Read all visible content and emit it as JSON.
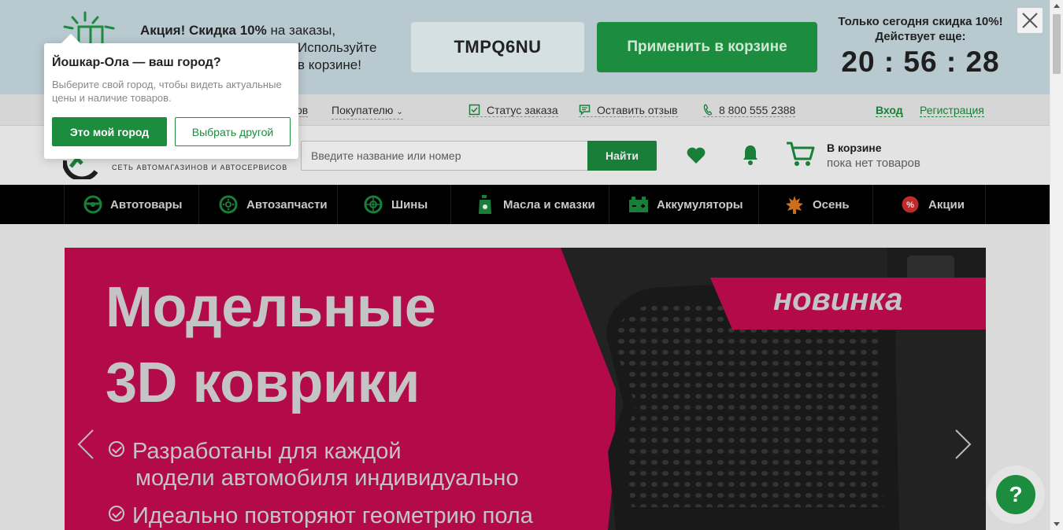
{
  "promo": {
    "bold": "Акция! Скидка 10%",
    "text": " на заказы,",
    "text2": "Используйте",
    "text3": "в корзине!",
    "code": "TMPQ6NU",
    "apply_label": "Применить в корзине",
    "timer_title_1": "Только сегодня скидка 10%!",
    "timer_title_2": "Действует еще:",
    "timer": "20 : 56 : 28"
  },
  "subnav": {
    "partial_item": "ов",
    "buyer": "Покупателю",
    "order_status": "Статус заказа",
    "leave_review": "Оставить отзыв",
    "phone": "8 800 555 2388",
    "login": "Вход",
    "register": "Регистрация"
  },
  "header": {
    "slogan": "сеть автомагазинов и автосервисов",
    "search_placeholder": "Введите название или номер",
    "search_button": "Найти",
    "cart_title": "В корзине",
    "cart_status": "пока нет товаров"
  },
  "categories": [
    {
      "label": "Автотовары",
      "icon": "steering-wheel-icon"
    },
    {
      "label": "Автозапчасти",
      "icon": "brake-disc-icon"
    },
    {
      "label": "Шины",
      "icon": "wheel-icon"
    },
    {
      "label": "Масла и смазки",
      "icon": "oil-can-icon"
    },
    {
      "label": "Аккумуляторы",
      "icon": "battery-icon"
    },
    {
      "label": "Осень",
      "icon": "leaf-icon"
    },
    {
      "label": "Акции",
      "icon": "percent-icon"
    }
  ],
  "banner": {
    "line1": "Модельные",
    "line2": "3D коврики",
    "tag": "новинка",
    "bullet1_a": "Разработаны для каждой",
    "bullet1_b": "модели автомобиля индивидуально",
    "bullet2": "Идеально повторяют геометрию пола"
  },
  "popup": {
    "title": "Йошкар-Ола — ваш город?",
    "text": "Выберите свой город, чтобы видеть актуальные цены и наличие товаров.",
    "confirm": "Это мой город",
    "choose_other": "Выбрать другой"
  },
  "help": {
    "symbol": "?"
  },
  "colors": {
    "brand_green": "#1c8c3e",
    "banner_pink": "#c50c52"
  }
}
